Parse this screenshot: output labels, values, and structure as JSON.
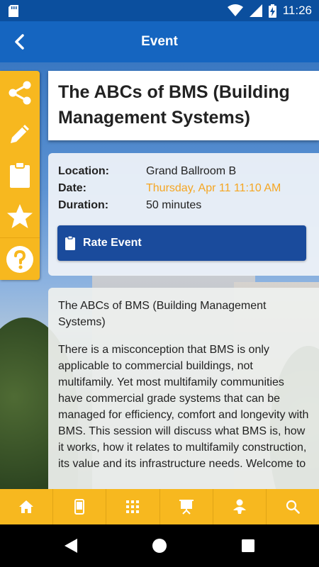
{
  "status_bar": {
    "time": "11:26",
    "icons": [
      "sd-card-icon",
      "wifi-icon",
      "signal-icon",
      "battery-charging-icon"
    ]
  },
  "app_bar": {
    "title": "Event",
    "back_icon": "back-arrow-icon"
  },
  "rail": {
    "items": [
      {
        "name": "share",
        "icon": "share-icon"
      },
      {
        "name": "notes",
        "icon": "pencil-icon"
      },
      {
        "name": "survey",
        "icon": "clipboard-icon"
      },
      {
        "name": "favorite",
        "icon": "star-icon"
      },
      {
        "name": "help",
        "icon": "help-icon"
      }
    ]
  },
  "event": {
    "title": "The ABCs of BMS (Building Management Systems)",
    "location_label": "Location:",
    "location": "Grand Ballroom B",
    "date_label": "Date:",
    "date": "Thursday, Apr 11 11:10 AM",
    "duration_label": "Duration:",
    "duration": "50 minutes",
    "rate_label": "Rate Event",
    "description_title": "The ABCs of BMS (Building Management Systems)",
    "description": "There is a misconception that BMS is only applicable to commercial buildings, not multifamily. Yet most multifamily communities have commercial grade systems that can be managed for efficiency, comfort and longevity with BMS. This session will discuss what BMS is, how it works, how it relates to multifamily construction, its value and its infrastructure needs. Welcome to"
  },
  "colors": {
    "status_bar": "#0b4f9e",
    "app_bar": "#1565c0",
    "accent_yellow": "#f7b81f",
    "date_orange": "#f5a623",
    "rate_button": "#1a4b9c"
  },
  "bottom_nav": {
    "items": [
      {
        "name": "home",
        "icon": "home-icon"
      },
      {
        "name": "mobile",
        "icon": "phone-icon"
      },
      {
        "name": "grid",
        "icon": "grid-icon"
      },
      {
        "name": "presentation",
        "icon": "presentation-icon"
      },
      {
        "name": "attendee",
        "icon": "person-icon"
      },
      {
        "name": "search",
        "icon": "search-icon"
      }
    ]
  }
}
